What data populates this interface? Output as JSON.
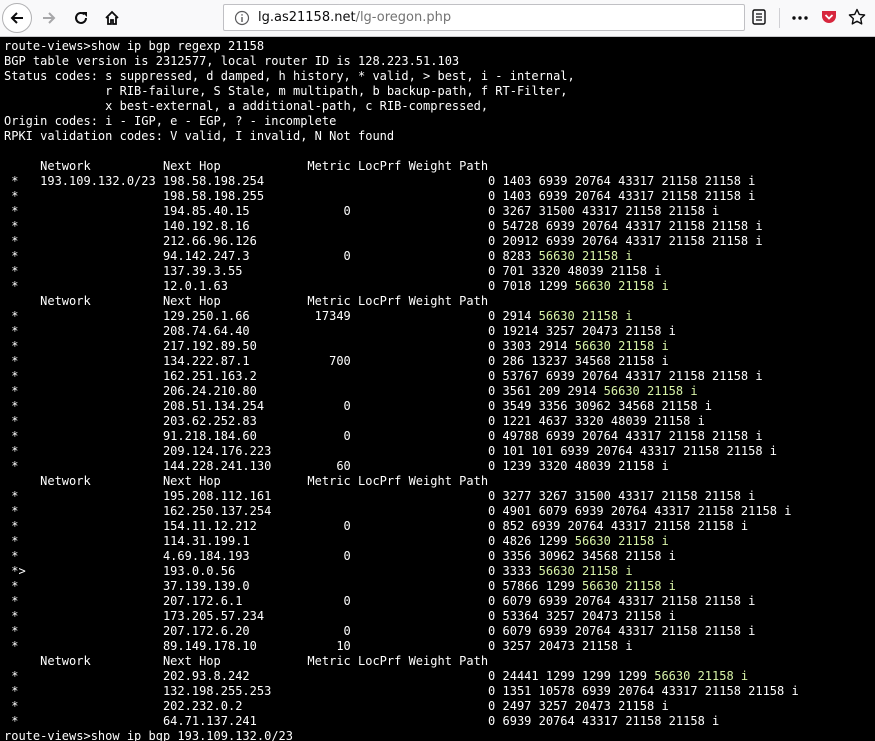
{
  "browser": {
    "url_host": "lg.as21158.net",
    "url_path": "/lg-oregon.php",
    "icons": [
      "back-arrow-icon",
      "forward-arrow-icon",
      "reload-icon",
      "home-icon",
      "info-icon",
      "reader-view-icon",
      "more-icon",
      "pocket-icon",
      "star-icon"
    ]
  },
  "colors": {
    "terminal_bg": "#000000",
    "terminal_fg": "#ffffff",
    "highlight": "#d8f3a8"
  },
  "terminal": {
    "prompt": "route-views>",
    "command": "show ip bgp regexp 21158",
    "header_lines": [
      "BGP table version is 2312577, local router ID is 128.223.51.103",
      "Status codes: s suppressed, d damped, h history, * valid, > best, i - internal,",
      "              r RIB-failure, S Stale, m multipath, b backup-path, f RT-Filter,",
      "              x best-external, a additional-path, c RIB-compressed,",
      "Origin codes: i - IGP, e - EGP, ? - incomplete",
      "RPKI validation codes: V valid, I invalid, N Not found"
    ],
    "columns": {
      "network": "Network",
      "next_hop": "Next Hop",
      "metric": "Metric",
      "locprf": "LocPrf",
      "weight": "Weight",
      "path": "Path"
    },
    "groups": [
      {
        "network": "193.109.132.0/23",
        "rows": [
          {
            "status": "*",
            "next_hop": "198.58.198.254",
            "metric": "",
            "weight": "0",
            "path": "1403 6939 20764 43317 21158 21158 i"
          },
          {
            "status": "*",
            "next_hop": "198.58.198.255",
            "metric": "",
            "weight": "0",
            "path": "1403 6939 20764 43317 21158 21158 i"
          },
          {
            "status": "*",
            "next_hop": "194.85.40.15",
            "metric": "0",
            "weight": "0",
            "path": "3267 31500 43317 21158 21158 i"
          },
          {
            "status": "*",
            "next_hop": "140.192.8.16",
            "metric": "",
            "weight": "0",
            "path": "54728 6939 20764 43317 21158 21158 i"
          },
          {
            "status": "*",
            "next_hop": "212.66.96.126",
            "metric": "",
            "weight": "0",
            "path": "20912 6939 20764 43317 21158 21158 i"
          },
          {
            "status": "*",
            "next_hop": "94.142.247.3",
            "metric": "0",
            "weight": "0",
            "path": "8283 ",
            "hl": "56630 21158 i"
          },
          {
            "status": "*",
            "next_hop": "137.39.3.55",
            "metric": "",
            "weight": "0",
            "path": "701 3320 48039 21158 i"
          },
          {
            "status": "*",
            "next_hop": "12.0.1.63",
            "metric": "",
            "weight": "0",
            "path": "7018 1299 ",
            "hl": "56630 21158 i"
          }
        ]
      },
      {
        "network": "",
        "rows": [
          {
            "status": "*",
            "next_hop": "129.250.1.66",
            "metric": "17349",
            "weight": "0",
            "path": "2914 ",
            "hl": "56630 21158 i"
          },
          {
            "status": "*",
            "next_hop": "208.74.64.40",
            "metric": "",
            "weight": "0",
            "path": "19214 3257 20473 21158 i"
          },
          {
            "status": "*",
            "next_hop": "217.192.89.50",
            "metric": "",
            "weight": "0",
            "path": "3303 2914 ",
            "hl": "56630 21158 i"
          },
          {
            "status": "*",
            "next_hop": "134.222.87.1",
            "metric": "700",
            "weight": "0",
            "path": "286 13237 34568 21158 i"
          },
          {
            "status": "*",
            "next_hop": "162.251.163.2",
            "metric": "",
            "weight": "0",
            "path": "53767 6939 20764 43317 21158 21158 i"
          },
          {
            "status": "*",
            "next_hop": "206.24.210.80",
            "metric": "",
            "weight": "0",
            "path": "3561 209 2914 ",
            "hl": "56630 21158 i"
          },
          {
            "status": "*",
            "next_hop": "208.51.134.254",
            "metric": "0",
            "weight": "0",
            "path": "3549 3356 30962 34568 21158 i"
          },
          {
            "status": "*",
            "next_hop": "203.62.252.83",
            "metric": "",
            "weight": "0",
            "path": "1221 4637 3320 48039 21158 i"
          },
          {
            "status": "*",
            "next_hop": "91.218.184.60",
            "metric": "0",
            "weight": "0",
            "path": "49788 6939 20764 43317 21158 21158 i"
          },
          {
            "status": "*",
            "next_hop": "209.124.176.223",
            "metric": "",
            "weight": "0",
            "path": "101 101 6939 20764 43317 21158 21158 i"
          },
          {
            "status": "*",
            "next_hop": "144.228.241.130",
            "metric": "60",
            "weight": "0",
            "path": "1239 3320 48039 21158 i"
          }
        ]
      },
      {
        "network": "",
        "rows": [
          {
            "status": "*",
            "next_hop": "195.208.112.161",
            "metric": "",
            "weight": "0",
            "path": "3277 3267 31500 43317 21158 21158 i"
          },
          {
            "status": "*",
            "next_hop": "162.250.137.254",
            "metric": "",
            "weight": "0",
            "path": "4901 6079 6939 20764 43317 21158 21158 i"
          },
          {
            "status": "*",
            "next_hop": "154.11.12.212",
            "metric": "0",
            "weight": "0",
            "path": "852 6939 20764 43317 21158 21158 i"
          },
          {
            "status": "*",
            "next_hop": "114.31.199.1",
            "metric": "",
            "weight": "0",
            "path": "4826 1299 ",
            "hl": "56630 21158 i"
          },
          {
            "status": "*",
            "next_hop": "4.69.184.193",
            "metric": "0",
            "weight": "0",
            "path": "3356 30962 34568 21158 i"
          },
          {
            "status": "*>",
            "next_hop": "193.0.0.56",
            "metric": "",
            "weight": "0",
            "path": "3333 ",
            "hl": "56630 21158 i"
          },
          {
            "status": "*",
            "next_hop": "37.139.139.0",
            "metric": "",
            "weight": "0",
            "path": "57866 1299 ",
            "hl": "56630 21158 i"
          },
          {
            "status": "*",
            "next_hop": "207.172.6.1",
            "metric": "0",
            "weight": "0",
            "path": "6079 6939 20764 43317 21158 21158 i"
          },
          {
            "status": "*",
            "next_hop": "173.205.57.234",
            "metric": "",
            "weight": "0",
            "path": "53364 3257 20473 21158 i"
          },
          {
            "status": "*",
            "next_hop": "207.172.6.20",
            "metric": "0",
            "weight": "0",
            "path": "6079 6939 20764 43317 21158 21158 i"
          },
          {
            "status": "*",
            "next_hop": "89.149.178.10",
            "metric": "10",
            "weight": "0",
            "path": "3257 20473 21158 i"
          }
        ]
      },
      {
        "network": "",
        "rows": [
          {
            "status": "*",
            "next_hop": "202.93.8.242",
            "metric": "",
            "weight": "0",
            "path": "24441 1299 1299 1299 ",
            "hl": "56630 21158 i"
          },
          {
            "status": "*",
            "next_hop": "132.198.255.253",
            "metric": "",
            "weight": "0",
            "path": "1351 10578 6939 20764 43317 21158 21158 i"
          },
          {
            "status": "*",
            "next_hop": "202.232.0.2",
            "metric": "",
            "weight": "0",
            "path": "2497 3257 20473 21158 i"
          },
          {
            "status": "*",
            "next_hop": "64.71.137.241",
            "metric": "",
            "weight": "0",
            "path": "6939 20764 43317 21158 21158 i"
          }
        ]
      }
    ],
    "next_command": "show ip bgp 193.109.132.0/23"
  }
}
